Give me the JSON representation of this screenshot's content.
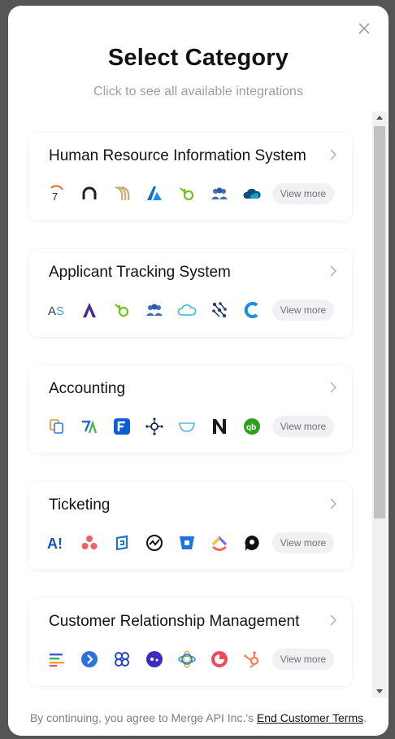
{
  "modal": {
    "title": "Select Category",
    "subtitle": "Click to see all available integrations"
  },
  "categories": [
    {
      "title": "Human Resource Information System",
      "view_more": "View more",
      "logos": [
        "seven-shifts-logo",
        "alexis-hr-logo",
        "bamboo-stripes-logo",
        "azure-logo",
        "bamboohr-logo",
        "team-people-logo",
        "cloud-logo"
      ]
    },
    {
      "title": "Applicant Tracking System",
      "view_more": "View more",
      "logos": [
        "as-logo",
        "a-logo",
        "bamboohr-logo",
        "team-people-logo",
        "cloud-outline-logo",
        "network-logo",
        "c-logo"
      ]
    },
    {
      "title": "Accounting",
      "view_more": "View more",
      "logos": [
        "copy-logo",
        "xa-logo",
        "freshbooks-logo",
        "hub-logo",
        "cup-logo",
        "netsuite-logo",
        "quickbooks-logo"
      ]
    },
    {
      "title": "Ticketing",
      "view_more": "View more",
      "logos": [
        "a-exclaim-logo",
        "asana-logo",
        "loop-logo",
        "pulse-logo",
        "bitbucket-logo",
        "clickup-logo",
        "chat-bubble-logo"
      ]
    },
    {
      "title": "Customer Relationship Management",
      "view_more": "View more",
      "logos": [
        "bars-logo",
        "play-circle-logo",
        "knot-logo",
        "dot-circle-logo",
        "sphere-logo",
        "copper-logo",
        "hubspot-logo"
      ]
    }
  ],
  "footer": {
    "text": "By continuing, you agree to Merge API Inc.'s ",
    "link": "End Customer Terms",
    "end": "."
  },
  "colors": {
    "title": "#121314",
    "muted": "#9b9ea3",
    "pill_bg": "#f1f1f3"
  }
}
